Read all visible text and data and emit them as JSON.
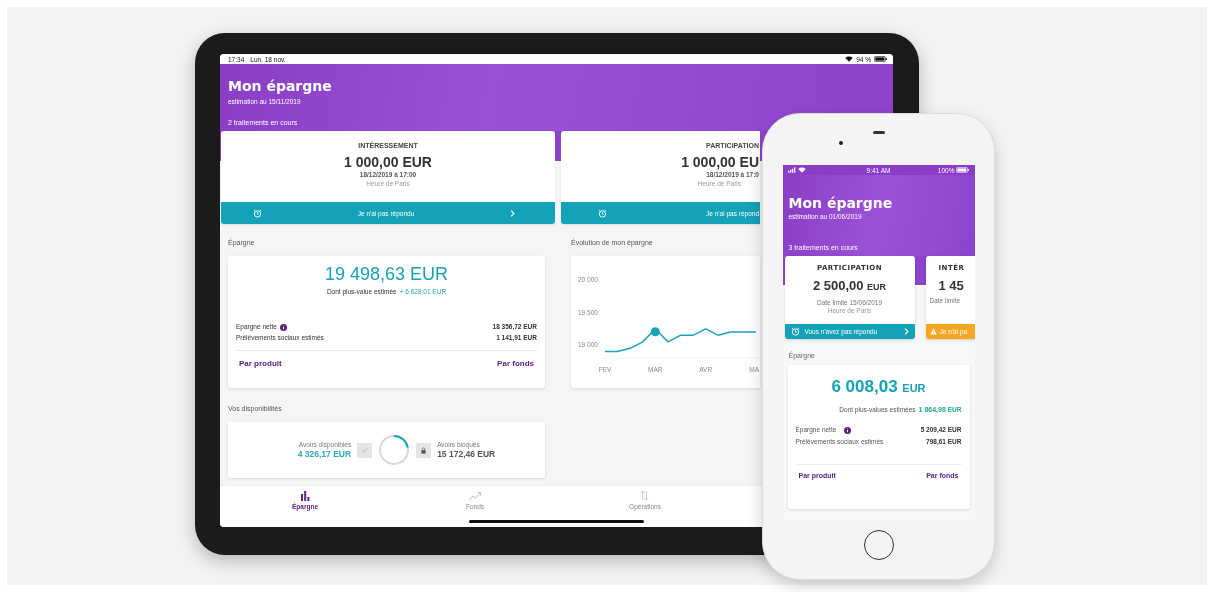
{
  "tablet": {
    "status_bar": {
      "time": "17:34",
      "date": "Lun. 18 nov.",
      "battery": "94 %"
    },
    "header": {
      "title": "Mon épargne",
      "subtitle": "estimation au 15/11/2019",
      "pending": "2 traitements en cours"
    },
    "pending_cards": [
      {
        "title": "INTÉRESSEMENT",
        "amount": "1 000,00 EUR",
        "deadline": "18/12/2019 à 17:00",
        "timezone": "Heure de Paris",
        "action": "Je n'ai pas répondu",
        "kind": "unanswered"
      },
      {
        "title": "PARTICIPATION",
        "amount": "1 000,00 EU",
        "deadline": "18/12/2019 à 17:0",
        "timezone": "Heure de Paris",
        "action": "Je n'ai pas répond",
        "kind": "unanswered"
      }
    ],
    "savings": {
      "label": "Épargne",
      "total": "19 498,63 EUR",
      "gain_label": "Dont plus-value estimée",
      "gain": "+ 6 628,01 EUR",
      "rows": [
        {
          "label": "Epargne nette",
          "value": "18 356,72 EUR",
          "info": true
        },
        {
          "label": "Prélèvements sociaux estimés",
          "value": "1 141,91 EUR"
        }
      ],
      "links": [
        "Par produit",
        "Par fonds"
      ]
    },
    "chart": {
      "chart_data": {
        "type": "line",
        "title": "Évolution de mon épargne",
        "categories": [
          "FEV",
          null,
          null,
          null,
          "MAR",
          null,
          null,
          null,
          "AVR",
          null,
          null,
          null,
          "MA"
        ],
        "series": [
          {
            "color": "#1aa3b8",
            "values": [
              18900,
              18900,
              18950,
              19050,
              19250,
              19050,
              19150,
              19150,
              19250,
              19150,
              19200,
              19200,
              19200
            ]
          }
        ],
        "ylim": [
          18800,
          20000
        ],
        "yticks": [
          {
            "value": 19000,
            "label": "19 000"
          },
          {
            "value": 19500,
            "label": "19 500"
          },
          {
            "value": 20000,
            "label": "20 000"
          }
        ]
      }
    },
    "availability": {
      "label": "Vos disponibilités",
      "available_label": "Avoirs disponibles",
      "available": "4 326,17 EUR",
      "level": 0.22,
      "blocked_label": "Avoirs bloqués",
      "blocked": "15 172,46 EUR"
    },
    "nav": [
      {
        "label": "Épargne",
        "kind": "savings",
        "selected": true
      },
      {
        "label": "Fonds",
        "kind": "funds",
        "selected": false
      },
      {
        "label": "Opérations",
        "kind": "operations",
        "selected": false
      }
    ]
  },
  "phone": {
    "status_bar": {
      "time": "9:41 AM",
      "battery": "100%"
    },
    "header": {
      "title": "Mon épargne",
      "subtitle": "estimation au 01/06/2019",
      "pending": "3 traitements en cours"
    },
    "pending_cards": [
      {
        "title": "PARTICIPATION",
        "amount": "2 500,00",
        "currency": "EUR",
        "deadline": "Date limite 15/06/2019",
        "timezone": "Heure de Paris",
        "action": "Vous n'avez pas répondu",
        "kind": "unanswered"
      },
      {
        "title": "INTÉR",
        "amount": "1 45",
        "deadline": "Date limite",
        "action": "Je n'ai pa",
        "kind": "warning"
      }
    ],
    "savings": {
      "label": "Épargne",
      "total": "6 008,03",
      "currency": "EUR",
      "gain_label": "Dont plus-values estimées",
      "gain": "1 864,98",
      "gain_currency": "EUR",
      "rows": [
        {
          "label": "Épargne nette",
          "value": "5 209,42 EUR",
          "info": true
        },
        {
          "label": "Prélèvements sociaux estimés",
          "value": "798,61 EUR"
        }
      ],
      "links": [
        "Par produit",
        "Par fonds"
      ]
    }
  }
}
